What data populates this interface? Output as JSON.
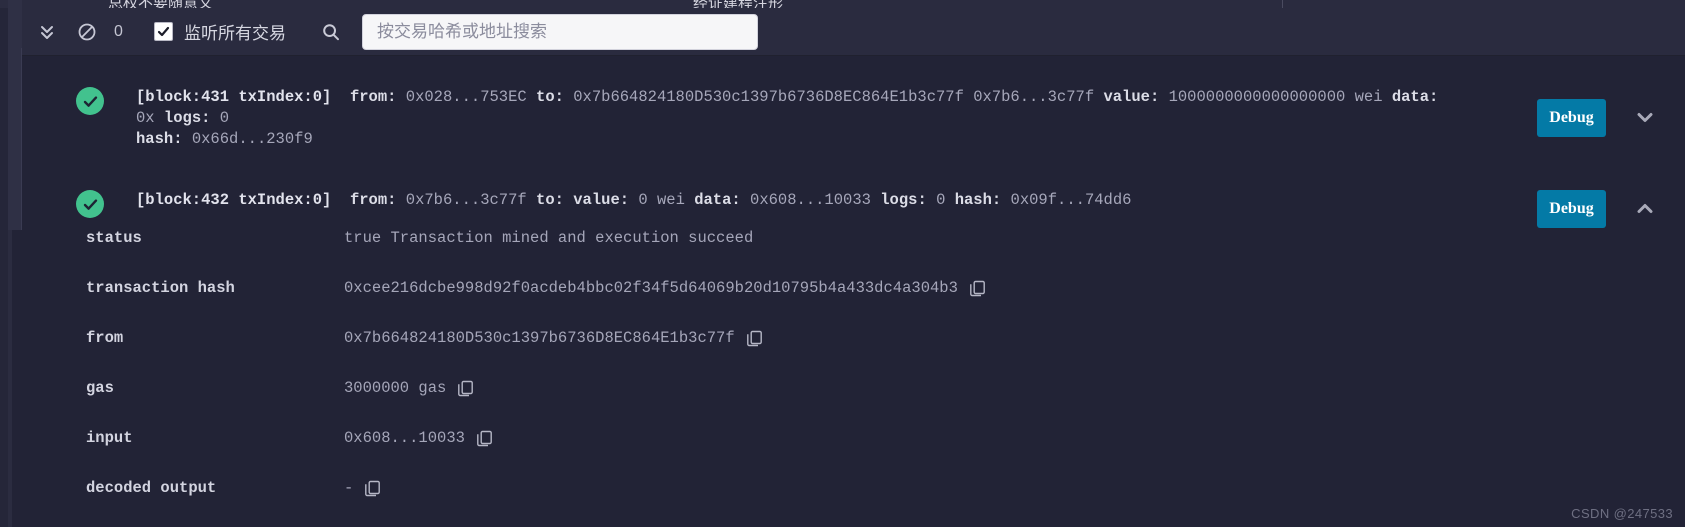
{
  "window": {
    "background_color": "#222336",
    "partial_top_tabs": [
      "总权不要随意义",
      "经证建程注形"
    ]
  },
  "toolbar": {
    "collapse_icon": "double-chevron-down-icon",
    "clear_icon": "ban-circle-icon",
    "count": "0",
    "listen_checkbox_checked": true,
    "listen_label": "监听所有交易",
    "search_icon": "search-icon",
    "search_value": "",
    "search_placeholder": "按交易哈希或地址搜索"
  },
  "transactions": [
    {
      "status_icon": "check-circle-icon",
      "block_label": "[block:431 txIndex:0]",
      "fields": [
        {
          "key": "from:",
          "value": "0x028...753EC"
        },
        {
          "key": "to:",
          "value": "0x7b664824180D530c1397b6736D8EC864E1b3c77f 0x7b6...3c77f"
        },
        {
          "key": "value:",
          "value": "1000000000000000000 wei"
        },
        {
          "key": "data:",
          "value": "0x"
        },
        {
          "key": "logs:",
          "value": "0"
        },
        {
          "key": "hash:",
          "value": "0x66d...230f9"
        }
      ],
      "debug_label": "Debug",
      "caret_icon": "chevron-down-icon",
      "expanded": false
    },
    {
      "status_icon": "check-circle-icon",
      "block_label": "[block:432 txIndex:0]",
      "fields": [
        {
          "key": "from:",
          "value": "0x7b6...3c77f"
        },
        {
          "key": "to:",
          "value": ""
        },
        {
          "key": "value:",
          "value": "0 wei"
        },
        {
          "key": "data:",
          "value": "0x608...10033"
        },
        {
          "key": "logs:",
          "value": "0"
        },
        {
          "key": "hash:",
          "value": "0x09f...74dd6"
        }
      ],
      "debug_label": "Debug",
      "caret_icon": "chevron-up-icon",
      "expanded": true,
      "details": [
        {
          "key": "status",
          "value": "true Transaction mined and execution succeed",
          "copy": false
        },
        {
          "key": "transaction hash",
          "value": "0xcee216dcbe998d92f0acdeb4bbc02f34f5d64069b20d10795b4a433dc4a304b3",
          "copy": true
        },
        {
          "key": "from",
          "value": "0x7b664824180D530c1397b6736D8EC864E1b3c77f",
          "copy": true
        },
        {
          "key": "gas",
          "value": "3000000 gas",
          "copy": true
        },
        {
          "key": "input",
          "value": "0x608...10033",
          "copy": true
        },
        {
          "key": "decoded output",
          "value": "-",
          "copy": true
        }
      ]
    }
  ],
  "watermark": "CSDN @247533",
  "colors": {
    "accent_button": "#047aa6",
    "success": "#42c28e",
    "panel": "#222336",
    "toolbar": "#2a2b3f"
  }
}
